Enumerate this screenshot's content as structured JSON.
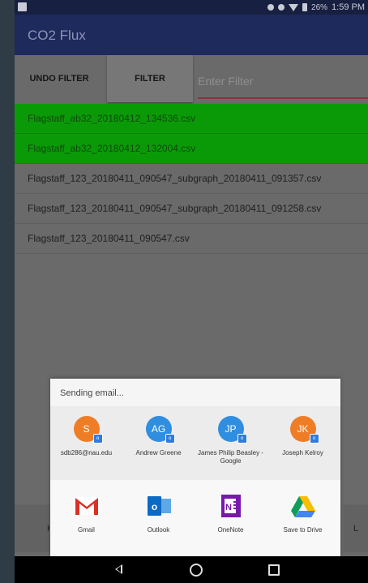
{
  "statusbar": {
    "battery": "26%",
    "time": "1:59 PM"
  },
  "app": {
    "title": "CO2 Flux"
  },
  "toolbar": {
    "undo_label": "UNDO FILTER",
    "filter_label": "FILTER",
    "filter_placeholder": "Enter Filter"
  },
  "files": [
    {
      "name": "Flagstaff_ab32_20180412_134536.csv",
      "highlight": true
    },
    {
      "name": "Flagstaff_ab32_20180412_132004.csv",
      "highlight": true
    },
    {
      "name": "Flagstaff_123_20180411_090547_subgraph_20180411_091357.csv",
      "highlight": false
    },
    {
      "name": "Flagstaff_123_20180411_090547_subgraph_20180411_091258.csv",
      "highlight": false
    },
    {
      "name": "Flagstaff_123_20180411_090547.csv",
      "highlight": false
    }
  ],
  "bottom_buttons": {
    "left": "H",
    "right": "L"
  },
  "share_sheet": {
    "title": "Sending email...",
    "people": [
      {
        "initials": "S",
        "label": "sdb286@nau.edu",
        "color": "#ef7d26"
      },
      {
        "initials": "AG",
        "label": "Andrew Greene",
        "color": "#2f8ee0"
      },
      {
        "initials": "JP",
        "label": "James Philip Beasley - Google",
        "color": "#2f8ee0"
      },
      {
        "initials": "JK",
        "label": "Joseph Kelroy",
        "color": "#ef7d26"
      }
    ],
    "apps": [
      {
        "label": "Gmail",
        "icon": "gmail-icon"
      },
      {
        "label": "Outlook",
        "icon": "outlook-icon"
      },
      {
        "label": "OneNote",
        "icon": "onenote-icon"
      },
      {
        "label": "Save to Drive",
        "icon": "google-drive-icon"
      }
    ]
  }
}
